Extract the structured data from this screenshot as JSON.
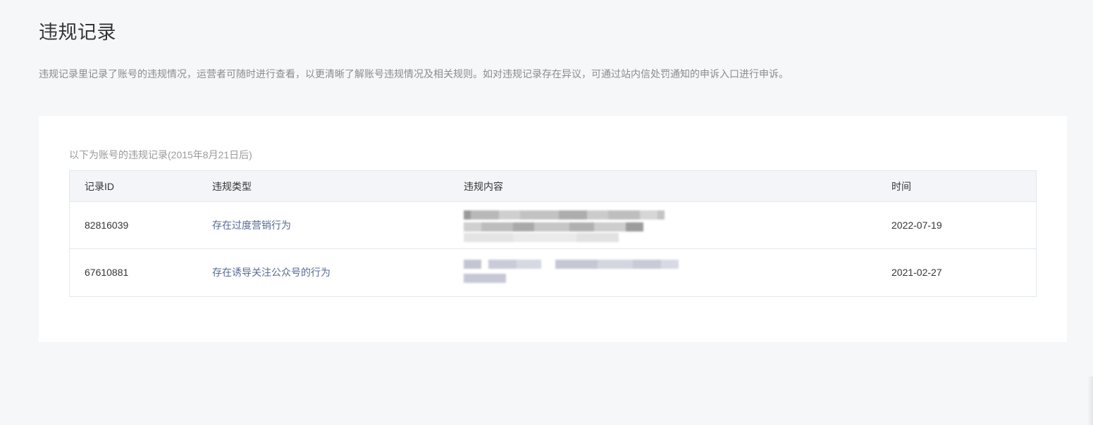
{
  "page": {
    "title": "违规记录",
    "description": "违规记录里记录了账号的违规情况，运营者可随时进行查看，以更清晰了解账号违规情况及相关规则。如对违规记录存在异议，可通过站内信处罚通知的申诉入口进行申诉。"
  },
  "records": {
    "caption": "以下为账号的违规记录(2015年8月21日后)",
    "columns": {
      "id": "记录ID",
      "type": "违规类型",
      "content": "违规内容",
      "time": "时间"
    },
    "rows": [
      {
        "id": "82816039",
        "type": "存在过度营销行为",
        "content": "",
        "time": "2022-07-19"
      },
      {
        "id": "67610881",
        "type": "存在诱导关注公众号的行为",
        "content": "",
        "time": "2021-02-27"
      }
    ]
  },
  "colors": {
    "background": "#f6f7f9",
    "card": "#ffffff",
    "header_row": "#f4f5f9",
    "link_text": "#576b95",
    "muted_text": "#8c8c8c"
  }
}
